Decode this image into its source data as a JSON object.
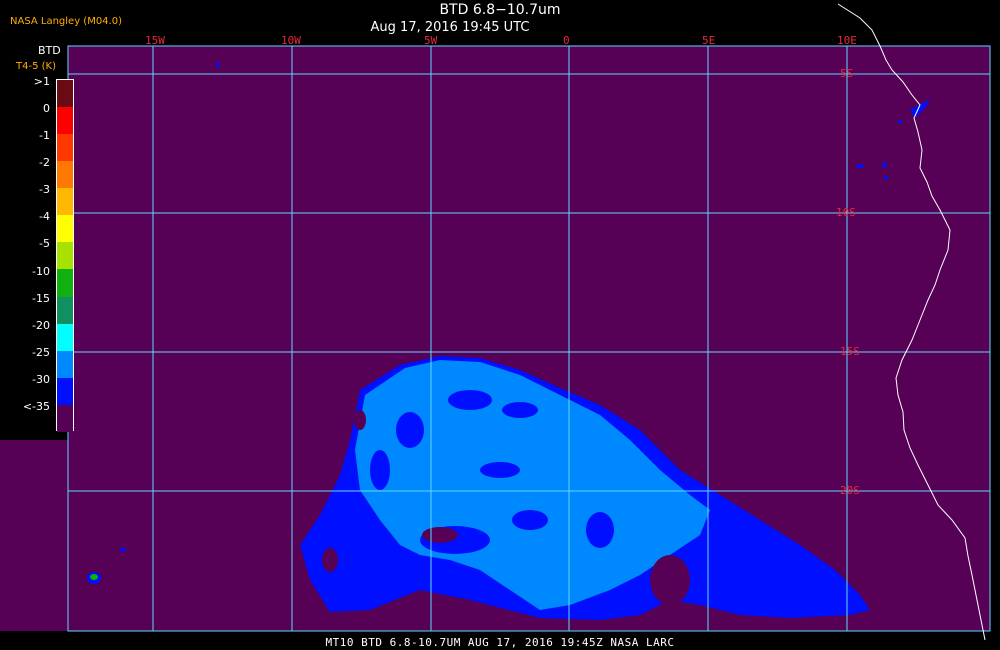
{
  "header": {
    "agency": "NASA Langley (M04.0)",
    "title": "BTD 6.8−10.7um",
    "subtitle": "Aug 17, 2016 19:45 UTC"
  },
  "legend": {
    "title": "BTD",
    "unit": "T4-5 (K)",
    "entries": [
      {
        "label": ">1",
        "color": "#6a0a12"
      },
      {
        "label": "0",
        "color": "#ff0000"
      },
      {
        "label": "-1",
        "color": "#ff3800"
      },
      {
        "label": "-2",
        "color": "#ff7800"
      },
      {
        "label": "-3",
        "color": "#ffb800"
      },
      {
        "label": "-4",
        "color": "#ffff00"
      },
      {
        "label": "-5",
        "color": "#a8e000"
      },
      {
        "label": "-10",
        "color": "#10b010"
      },
      {
        "label": "-15",
        "color": "#109060"
      },
      {
        "label": "-20",
        "color": "#00ffff"
      },
      {
        "label": "-25",
        "color": "#0088ff"
      },
      {
        "label": "-30",
        "color": "#0010ff"
      },
      {
        "label": "<-35",
        "color": "#560056"
      }
    ]
  },
  "grid": {
    "lon_labels": [
      "15W",
      "10W",
      "5W",
      "0",
      "5E",
      "10E"
    ],
    "lat_labels": [
      "5S",
      "10S",
      "15S",
      "20S"
    ]
  },
  "colors": {
    "background": "#560056",
    "grid": "#5fd8ff",
    "plume_light": "#0088ff",
    "plume_dark": "#0010ff",
    "coast": "#ffffff",
    "label": "#e8283c"
  },
  "footer": {
    "text": "MT10  BTD 6.8-10.7UM   AUG 17, 2016 19:45Z   NASA LARC"
  }
}
